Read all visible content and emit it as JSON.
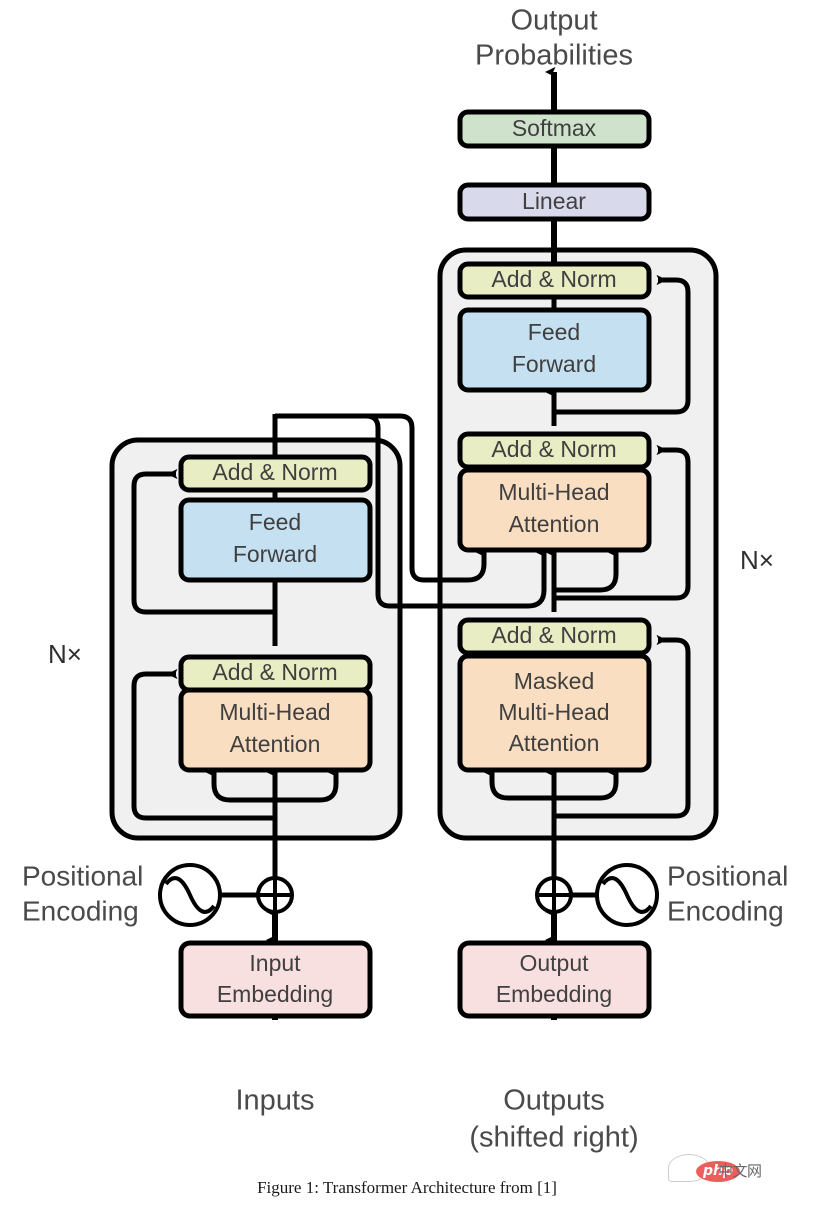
{
  "figure": {
    "caption": "Figure 1: Transformer Architecture from [1]",
    "title_top": [
      "Output",
      "Probabilities"
    ]
  },
  "colors": {
    "add_norm": "#e9edc4",
    "feed_forward": "#c5e1f1",
    "attention": "#fadec1",
    "embedding": "#f8dfe0",
    "softmax": "#cfe3cc",
    "linear": "#d8daec",
    "container": "#f0f0f0",
    "stroke": "#000000",
    "text": "#404040"
  },
  "top": {
    "output_line1": "Output",
    "output_line2": "Probabilities",
    "softmax": "Softmax",
    "linear": "Linear"
  },
  "encoder": {
    "repeat_label": "N×",
    "add_norm_top": "Add & Norm",
    "feed_forward_line1": "Feed",
    "feed_forward_line2": "Forward",
    "add_norm_bottom": "Add & Norm",
    "attention_line1": "Multi-Head",
    "attention_line2": "Attention"
  },
  "decoder": {
    "repeat_label": "N×",
    "add_norm_top": "Add & Norm",
    "feed_forward_line1": "Feed",
    "feed_forward_line2": "Forward",
    "add_norm_mid": "Add & Norm",
    "cross_attention_line1": "Multi-Head",
    "cross_attention_line2": "Attention",
    "add_norm_bottom": "Add & Norm",
    "masked_attention_line1": "Masked",
    "masked_attention_line2": "Multi-Head",
    "masked_attention_line3": "Attention"
  },
  "inputs": {
    "positional_line1": "Positional",
    "positional_line2": "Encoding",
    "embedding_line1": "Input",
    "embedding_line2": "Embedding",
    "source_label": "Inputs",
    "plus_symbol": "⊕"
  },
  "outputs": {
    "positional_line1": "Positional",
    "positional_line2": "Encoding",
    "embedding_line1": "Output",
    "embedding_line2": "Embedding",
    "source_line1": "Outputs",
    "source_line2": "(shifted right)",
    "plus_symbol": "⊕"
  },
  "watermark": {
    "logo_text": "php",
    "site_text": "中文网"
  }
}
